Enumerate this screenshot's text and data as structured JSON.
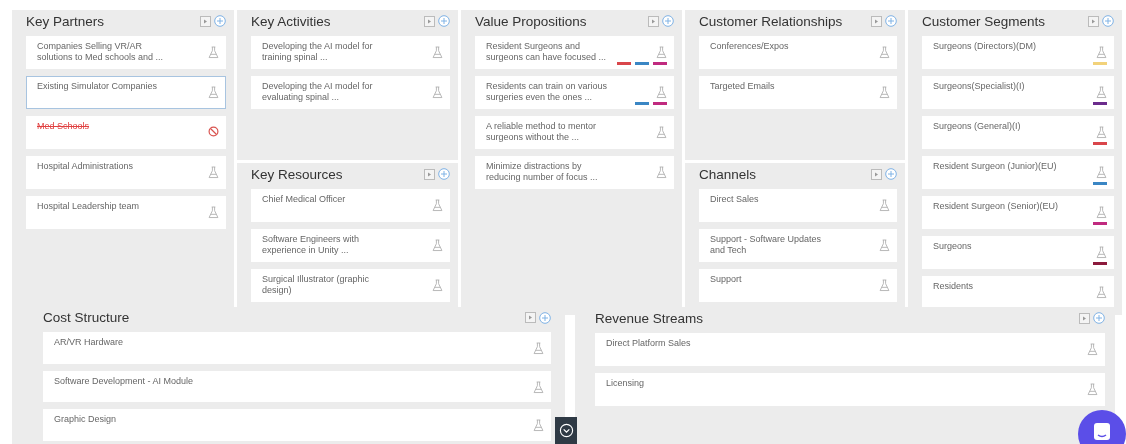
{
  "top_columns": [
    {
      "sections": [
        {
          "title": "Key Partners",
          "cards": [
            {
              "text": "Companies Selling VR/AR solutions to Med schools and ...",
              "selected": false,
              "kind": "hypothesis"
            },
            {
              "text": "Existing Simulator Companies",
              "selected": true,
              "kind": "hypothesis"
            },
            {
              "text": "Med Schools",
              "selected": false,
              "kind": "rejected"
            },
            {
              "text": "Hospital Administrations",
              "selected": false,
              "kind": "hypothesis"
            },
            {
              "text": "Hospital Leadership team",
              "selected": false,
              "kind": "hypothesis"
            }
          ]
        }
      ]
    },
    {
      "sections": [
        {
          "title": "Key Activities",
          "cards": [
            {
              "text": "Developing the AI model for training spinal ..."
            },
            {
              "text": "Developing the AI model for evaluating spinal ..."
            }
          ]
        },
        {
          "title": "Key Resources",
          "cards": [
            {
              "text": "Chief Medical Officer"
            },
            {
              "text": "Software Engineers with experience in Unity ..."
            },
            {
              "text": "Surgical Illustrator (graphic design)"
            }
          ]
        }
      ]
    },
    {
      "sections": [
        {
          "title": "Value Propositions",
          "cards": [
            {
              "text": "Resident Surgeons and surgeons can have focused ...",
              "tags": [
                {
                  "color": "#d9464b"
                },
                {
                  "color": "#3a86c4"
                },
                {
                  "color": "#c02a7f"
                }
              ]
            },
            {
              "text": "Residents can train on various surgeries even the ones ...",
              "tags": [
                {
                  "color": "#3a86c4"
                },
                {
                  "color": "#c02a7f"
                }
              ]
            },
            {
              "text": "A reliable method to mentor surgeons without the ..."
            },
            {
              "text": "Minimize distractions by reducing number of focus ..."
            }
          ]
        }
      ]
    },
    {
      "sections": [
        {
          "title": "Customer Relationships",
          "cards": [
            {
              "text": "Conferences/Expos"
            },
            {
              "text": "Targeted Emails"
            }
          ]
        },
        {
          "title": "Channels",
          "cards": [
            {
              "text": "Direct Sales"
            },
            {
              "text": "Support - Software Updates and Tech"
            },
            {
              "text": "Support"
            }
          ]
        }
      ]
    },
    {
      "sections": [
        {
          "title": "Customer Segments",
          "cards": [
            {
              "text": "Surgeons (Directors)(DM)",
              "tags": [
                {
                  "color": "#f2d27a"
                }
              ]
            },
            {
              "text": "Surgeons(Specialist)(I)",
              "tags": [
                {
                  "color": "#6b2c8c"
                }
              ]
            },
            {
              "text": "Surgeons (General)(I)",
              "tags": [
                {
                  "color": "#d9464b"
                }
              ]
            },
            {
              "text": "Resident Surgeon (Junior)(EU)",
              "tags": [
                {
                  "color": "#3a86c4"
                }
              ]
            },
            {
              "text": "Resident Surgeon (Senior)(EU)",
              "tags": [
                {
                  "color": "#c02a7f"
                }
              ]
            },
            {
              "text": "Surgeons",
              "tags": [
                {
                  "color": "#8c1a3c"
                }
              ]
            },
            {
              "text": "Residents"
            }
          ]
        }
      ]
    }
  ],
  "bottom_sections": [
    {
      "title": "Cost Structure",
      "cards": [
        {
          "text": "AR/VR Hardware"
        },
        {
          "text": "Software Development - AI Module"
        },
        {
          "text": "Graphic Design"
        }
      ]
    },
    {
      "title": "Revenue Streams",
      "cards": [
        {
          "text": "Direct Platform Sales"
        },
        {
          "text": "Licensing"
        }
      ]
    }
  ]
}
